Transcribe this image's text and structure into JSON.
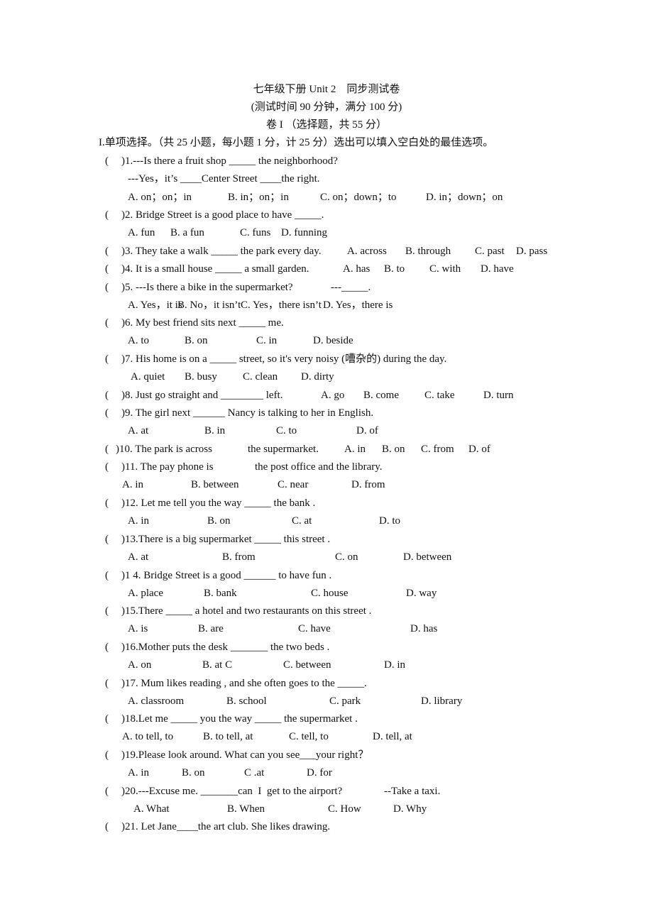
{
  "header": {
    "title": "七年级下册 Unit 2　同步测试卷",
    "subtitle": "(测试时间 90 分钟，满分 100 分)",
    "volume": "卷 I （选择题，共 55 分）",
    "section": "I.单项选择。（共 25 小题，每小题 1 分，计 25 分）选出可以填入空白处的最佳选项。"
  },
  "paren_open": "(",
  "questions": [
    {
      "stem": ")1.---Is there a fruit shop _____ the neighborhood?",
      "stem2": "---Yes，it’s ____Center Street ____the right.",
      "options": [
        "A. on；on；in",
        "B. in；on；in",
        "C. on；down；to",
        "D. in；down；on"
      ]
    },
    {
      "stem": ")2. Bridge Street is a good place to have _____.",
      "options": [
        "A. fun",
        "B. a fun",
        "C. funs",
        "D. funning"
      ]
    },
    {
      "stem": ")3. They take a walk _____ the park every day.",
      "options": [
        "A. across",
        "B. through",
        "C. past",
        "D. pass"
      ]
    },
    {
      "stem": ")4. It is a small house _____ a small garden.",
      "options": [
        "A. has",
        "B. to",
        "C. with",
        "D. have"
      ]
    },
    {
      "stem": ")5. ---Is there a bike in the supermarket?",
      "answer_blank": "---_____.",
      "options": [
        "A. Yes，it is",
        "B. No，it isn’t",
        "C. Yes，there isn’t",
        "D. Yes，there is"
      ]
    },
    {
      "stem": ")6. My best friend sits next _____ me.",
      "options": [
        "A. to",
        "B. on",
        "C. in",
        "D. beside"
      ]
    },
    {
      "stem": ")7. His home is on a _____ street, so it's very noisy (嘈杂的) during the day.",
      "options": [
        "A. quiet",
        "B. busy",
        "C. clean",
        "D. dirty"
      ]
    },
    {
      "stem": ")8. Just go straight and ________ left.",
      "options": [
        "A. go",
        "B. come",
        "C. take",
        "D. turn"
      ]
    },
    {
      "stem": ")9. The girl next ______ Nancy is talking to her in English.",
      "options": [
        "A. at",
        "B. in",
        "C. to",
        "D. of"
      ]
    },
    {
      "stem": ")10. The park is across",
      "stem_tail": "the supermarket.",
      "options": [
        "A. in",
        "B. on",
        "C. from",
        "D. of"
      ]
    },
    {
      "stem": ")11. The pay phone is",
      "stem_tail": "the post office and the library.",
      "options": [
        "A. in",
        "B. between",
        "C. near",
        "D. from"
      ]
    },
    {
      "stem": ")12. Let me tell you the way _____ the bank .",
      "options": [
        "A. in",
        "B. on",
        "C. at",
        "D. to"
      ]
    },
    {
      "stem": ")13.There is a big supermarket _____ this street .",
      "options": [
        "A. at",
        "B. from",
        "C. on",
        "D. between"
      ]
    },
    {
      "stem": ")1 4. Bridge Street is a good ______ to have fun .",
      "options": [
        "A. place",
        "B. bank",
        "C. house",
        "D. way"
      ]
    },
    {
      "stem": ")15.There _____ a hotel and two restaurants on this street .",
      "options": [
        "A. is",
        "B. are",
        "C. have",
        "D. has"
      ]
    },
    {
      "stem": ")16.Mother puts the desk _______ the two beds .",
      "options": [
        "A. on",
        "B. at C",
        "C. between",
        "D. in"
      ]
    },
    {
      "stem": ")17. Mum likes reading , and she often goes to the _____.",
      "options": [
        "A. classroom",
        "B. school",
        "C. park",
        "D. library"
      ]
    },
    {
      "stem": ")18.Let me _____ you the way _____ the supermarket .",
      "options": [
        "A. to tell, to",
        "B. to tell, at",
        "C. tell, to",
        "D. tell, at"
      ]
    },
    {
      "stem": ")19.Please look around. What can you see___your right？",
      "options": [
        "A. in",
        "B. on",
        "C .at",
        "D. for"
      ]
    },
    {
      "stem": ")20.---Excuse me. _______can  I  get to the airport?",
      "answer": "--Take a taxi.",
      "options": [
        "A. What",
        "B. When",
        "C. How",
        "D. Why"
      ]
    },
    {
      "stem": ")21. Let Jane____the art club. She likes drawing."
    }
  ]
}
